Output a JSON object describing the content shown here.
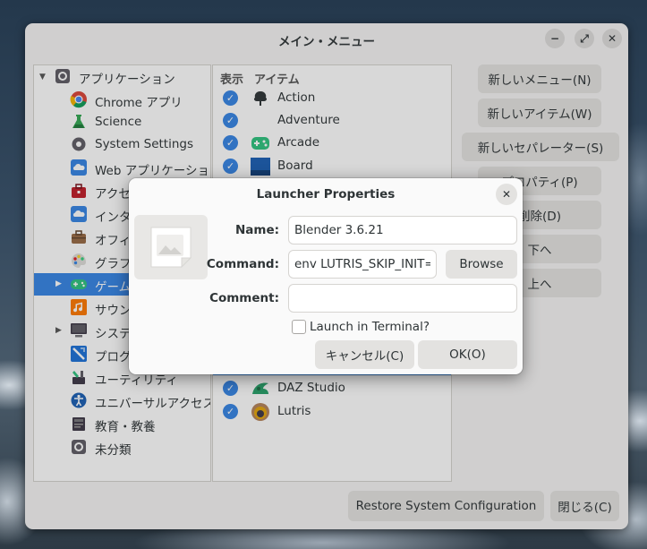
{
  "window": {
    "title": "メイン・メニュー",
    "minimize_glyph": "−",
    "maximize_glyph": "⤢",
    "close_glyph": "✕"
  },
  "tree": {
    "root_label": "アプリケーション",
    "items": [
      {
        "label": "Chrome アプリ",
        "icon": "chrome-icon"
      },
      {
        "label": "Science",
        "icon": "flask-icon"
      },
      {
        "label": "System Settings",
        "icon": "gear-icon"
      },
      {
        "label": "Web アプリケーション",
        "icon": "cloud-icon"
      },
      {
        "label": "アクセ",
        "icon": "toolbox-icon"
      },
      {
        "label": "インタ",
        "icon": "cloud-icon"
      },
      {
        "label": "オフィ",
        "icon": "briefcase-icon"
      },
      {
        "label": "グラフ",
        "icon": "palette-icon"
      },
      {
        "label": "ゲーム",
        "icon": "gamepad-icon",
        "selected": true,
        "expander": true
      },
      {
        "label": "サウン",
        "icon": "music-icon"
      },
      {
        "label": "システ",
        "icon": "monitor-icon",
        "expander": true
      },
      {
        "label": "プログ",
        "icon": "code-icon"
      },
      {
        "label": "ユーティリティ",
        "icon": "utilities-icon"
      },
      {
        "label": "ユニバーサルアクセス",
        "icon": "accessibility-icon"
      },
      {
        "label": "教育・教養",
        "icon": "education-icon"
      },
      {
        "label": "未分類",
        "icon": "gear-icon"
      }
    ]
  },
  "items_pane": {
    "col_show": "表示",
    "col_item": "アイテム",
    "rows": [
      {
        "label": "Action",
        "icon": "action-icon"
      },
      {
        "label": "Adventure",
        "icon": ""
      },
      {
        "label": "Arcade",
        "icon": "arcade-icon"
      },
      {
        "label": "Board",
        "icon": "board-icon"
      },
      {
        "label": "DAZ Studio",
        "icon": "daz-icon"
      },
      {
        "label": "Lutris",
        "icon": "lutris-icon"
      }
    ]
  },
  "buttons": {
    "new_menu": "新しいメニュー(N)",
    "new_item": "新しいアイテム(W)",
    "new_separator": "新しいセパレーター(S)",
    "properties": "プロパティ(P)",
    "delete": "削除(D)",
    "move_down": "下へ",
    "move_up": "上へ",
    "restore": "Restore System Configuration",
    "close": "閉じる(C)"
  },
  "dialog": {
    "title": "Launcher Properties",
    "close_glyph": "✕",
    "name_label": "Name:",
    "name_value": "Blender 3.6.21",
    "command_label": "Command:",
    "command_value": "env LUTRIS_SKIP_INIT=",
    "browse": "Browse",
    "comment_label": "Comment:",
    "comment_value": "",
    "terminal_label": "Launch in Terminal?",
    "cancel": "キャンセル(C)",
    "ok": "OK(O)"
  },
  "colors": {
    "accent": "#3584e4",
    "window_bg": "#f6f5f4"
  }
}
